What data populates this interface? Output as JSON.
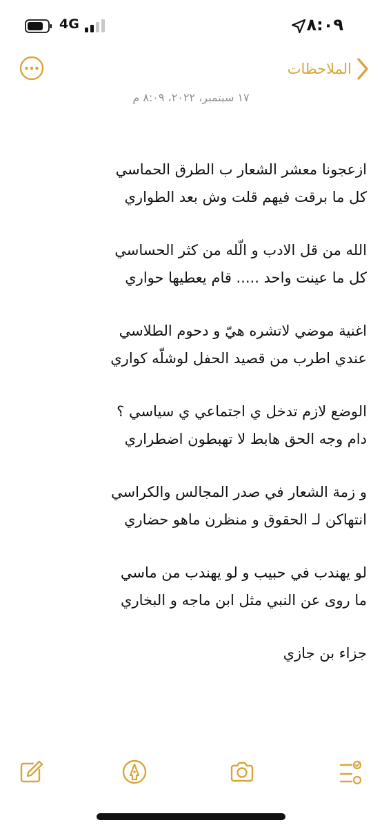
{
  "status_bar": {
    "time": "٨:٠٩",
    "network": "4G"
  },
  "nav": {
    "back_label": "الملاحظات"
  },
  "note": {
    "date": "١٧ سبتمبر، ٢٠٢٢، ٨:٠٩ م",
    "stanzas": [
      [
        "ازعجونا معشر الشعار ب الطرق الحماسي",
        "كل ما برقت فيهم قلت وش بعد الطواري"
      ],
      [
        "الله من قل الادب و الّله من كثر الحساسي",
        "كل ما عينت واحد ..... قام يعطيها حواري"
      ],
      [
        "اغنية موضي لاتشره هيّ و دحوم الطلاسي",
        "عندي اطرب من قصيد الحفل لوشلّه كواري"
      ],
      [
        "الوضع لازم تدخل ي اجتماعي ي سياسي ؟",
        "دام وجه الحق هابط لا تهبطون اضطراري"
      ],
      [
        "و زمة الشعار في صدر المجالس والكراسي",
        "انتهاكن لـ الحقوق و منظرن ماهو حضاري"
      ],
      [
        "لو يهندب في حبيب و لو يهندب من ماسي",
        "ما روى عن النبي مثل ابن ماجه و البخاري"
      ]
    ],
    "signature": "جزاء بن جازي"
  },
  "colors": {
    "accent": "#d9a53a",
    "secondary_text": "#8e8e93"
  },
  "icons": {
    "back": "chevron-left-icon",
    "more": "ellipsis-circle-icon",
    "checklist": "checklist-icon",
    "camera": "camera-icon",
    "markup": "pen-tip-circle-icon",
    "compose": "compose-icon"
  }
}
